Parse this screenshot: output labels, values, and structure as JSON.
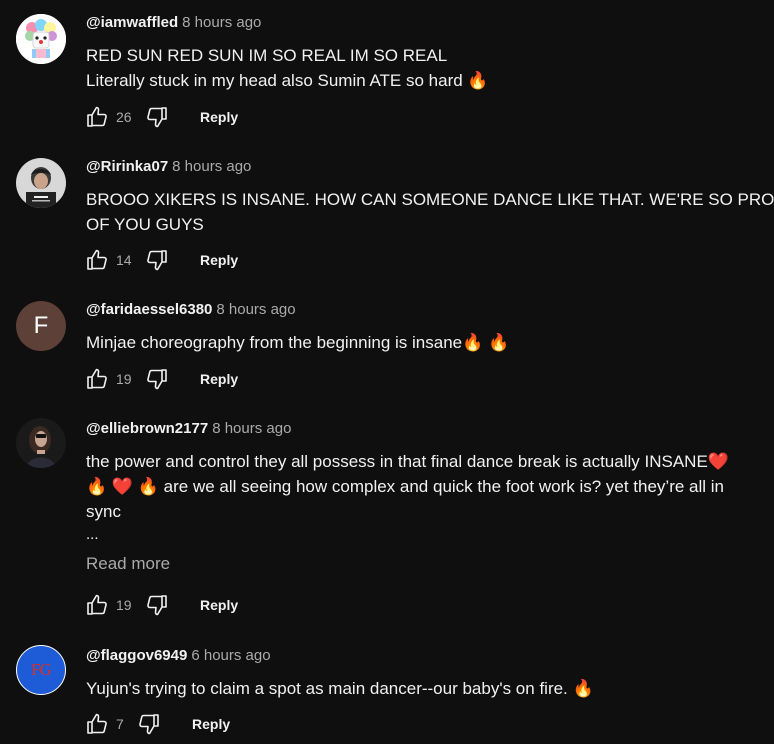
{
  "comments": [
    {
      "author": "@iamwaffled",
      "time": "8 hours ago",
      "lines": [
        "RED SUN RED SUN IM SO REAL IM SO REAL",
        "Literally stuck in my head also Sumin ATE so hard 🔥"
      ],
      "likes": "26",
      "reply_label": "Reply",
      "avatar": "clown-avatar"
    },
    {
      "author": "@Ririnka07",
      "time": "8 hours ago",
      "lines": [
        "BROOO XIKERS IS INSANE. HOW CAN SOMEONE DANCE LIKE THAT. WE'RE SO PROUD",
        "OF YOU GUYS"
      ],
      "likes": "14",
      "reply_label": "Reply",
      "avatar": "photo-avatar"
    },
    {
      "author": "@faridaessel6380",
      "time": "8 hours ago",
      "lines": [
        "Minjae choreography from the beginning is insane🔥 🔥"
      ],
      "likes": "19",
      "reply_label": "Reply",
      "avatar_letter": "F",
      "avatar_color": "#5d4037"
    },
    {
      "author": "@elliebrown2177",
      "time": "8 hours ago",
      "lines": [
        "the power and control they all possess in that final dance break is actually INSANE❤️",
        "🔥 ❤️ 🔥  are we all seeing how complex and quick the foot work is? yet they’re all in",
        "sync"
      ],
      "ellipsis": "...",
      "read_more": "Read more",
      "likes": "19",
      "reply_label": "Reply",
      "avatar": "photo-avatar-dark"
    },
    {
      "author": "@flaggov6949",
      "time": "6 hours ago",
      "lines": [
        "Yujun's trying to claim a spot as main dancer--our baby's on fire. 🔥"
      ],
      "likes": "7",
      "reply_label": "Reply",
      "avatar_letters": "FG",
      "avatar_color": "#1e5bd6",
      "avatar_text_color": "#d93025"
    }
  ],
  "colors": {
    "background": "#0f0f0f",
    "text_primary": "#f1f1f1",
    "text_secondary": "#aaaaaa"
  }
}
